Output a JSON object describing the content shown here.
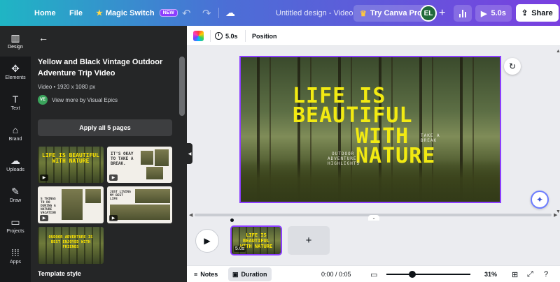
{
  "topbar": {
    "home": "Home",
    "file": "File",
    "magic_switch": "Magic Switch",
    "new_badge": "NEW",
    "title": "Untitled design - Video",
    "try_canva_pro": "Try Canva Pro",
    "avatar_initials": "EL",
    "play_duration": "5.0s",
    "share": "Share"
  },
  "rail": {
    "items": [
      {
        "label": "Design",
        "icon": "design-icon"
      },
      {
        "label": "Elements",
        "icon": "elements-icon"
      },
      {
        "label": "Text",
        "icon": "text-icon"
      },
      {
        "label": "Brand",
        "icon": "brand-icon"
      },
      {
        "label": "Uploads",
        "icon": "uploads-icon"
      },
      {
        "label": "Draw",
        "icon": "draw-icon"
      },
      {
        "label": "Projects",
        "icon": "projects-icon"
      },
      {
        "label": "Apps",
        "icon": "apps-icon"
      }
    ]
  },
  "panel": {
    "title": "Yellow and Black Vintage Outdoor Adventure Trip Video",
    "meta": "Video • 1920 x 1080 px",
    "author_initials": "VE",
    "author": "View more by Visual Epics",
    "apply_button": "Apply all 5 pages",
    "template_style": "Template style",
    "thumbnails": {
      "t1": "LIFE IS BEAUTIFUL WITH NATURE",
      "t2": "IT'S OKAY TO TAKE A BREAK.",
      "t3": "5 THINGS TO DO DURING A NATURE VACATION",
      "t4": "JUST LIVING MY BEST LIFE",
      "t5": "OUDOOR ADVENTURE IS BEST ENJOYED WITH FRIENDS"
    }
  },
  "context_toolbar": {
    "duration": "5.0s",
    "position": "Position"
  },
  "canvas": {
    "headline_1": "LIFE IS",
    "headline_2": "BEAUTIFUL",
    "headline_3": "WITH",
    "headline_4": "NATURE",
    "side_text_1": "TAKE A",
    "side_text_2": "BREAK",
    "small_text_1": "OUTDOOR",
    "small_text_2": "ADVENTURE",
    "small_text_3": "HIGHLIGHTS"
  },
  "timeline": {
    "clip_duration": "5.0s",
    "clip_text": "LIFE IS BEAUTIFUL WITH NATURE"
  },
  "footer": {
    "notes": "Notes",
    "duration": "Duration",
    "time": "0:00 / 0:05",
    "zoom": "31%"
  },
  "colors": {
    "accent": "#8b3dff",
    "headline": "#f2ea12",
    "rail_bg": "#18191b",
    "panel_bg": "#252627"
  }
}
